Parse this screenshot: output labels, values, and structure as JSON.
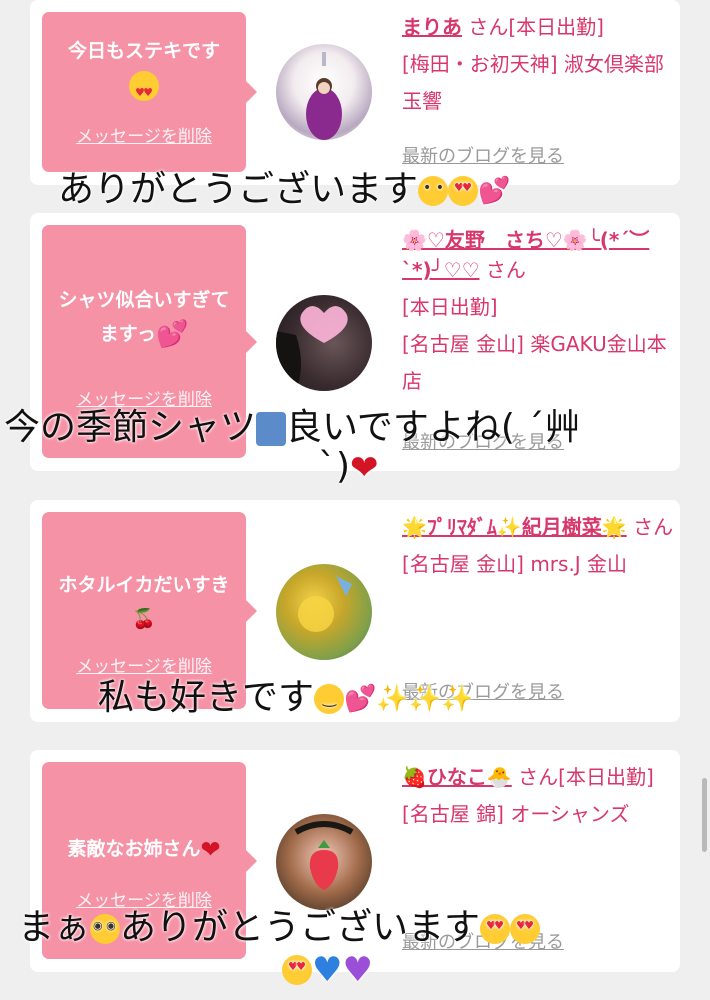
{
  "cards": [
    {
      "message": "今日もステキです",
      "delete_label": "メッセージを削除",
      "name": "まりあ",
      "name_suffix": "さん[本日出勤]",
      "shop": "[梅田・お初天神] 淑女倶楽部 玉響",
      "blog_link": "最新のブログを見る"
    },
    {
      "message": "シャツ似合いすぎてますっ",
      "delete_label": "メッセージを削除",
      "name": "🌸♡友野　さち♡🌸╰(*´︶`*)╯♡♡",
      "name_suffix": "さん",
      "status": "[本日出勤]",
      "shop": "[名古屋 金山] 楽GAKU金山本店",
      "blog_link": "最新のブログを見る"
    },
    {
      "message": "ホタルイカだいすき",
      "delete_label": "メッセージを削除",
      "name": "🌟ﾌﾟﾘﾏﾀﾞﾑ✨紀月樹菜🌟",
      "name_suffix": "さん",
      "shop": "[名古屋 金山] mrs.J 金山",
      "blog_link": "最新のブログを見る"
    },
    {
      "message": "素敵なお姉さん",
      "delete_label": "メッセージを削除",
      "name": "🍓ひなこ🐣",
      "name_suffix": "さん[本日出勤]",
      "shop": "[名古屋 錦] オーシャンズ",
      "blog_link": "最新のブログを見る"
    }
  ],
  "captions": {
    "c1": "ありがとうございます",
    "c2_line1": "今の季節シャツ",
    "c2_line1b": "良いですよね( ´艸",
    "c2_line2": "`)",
    "c3": "私も好きです",
    "c4_line1a": "まぁ",
    "c4_line1b": "ありがとうございます"
  },
  "colors": {
    "bubble": "#f592a6",
    "accent": "#d8376b",
    "link": "#9a9a9a"
  }
}
